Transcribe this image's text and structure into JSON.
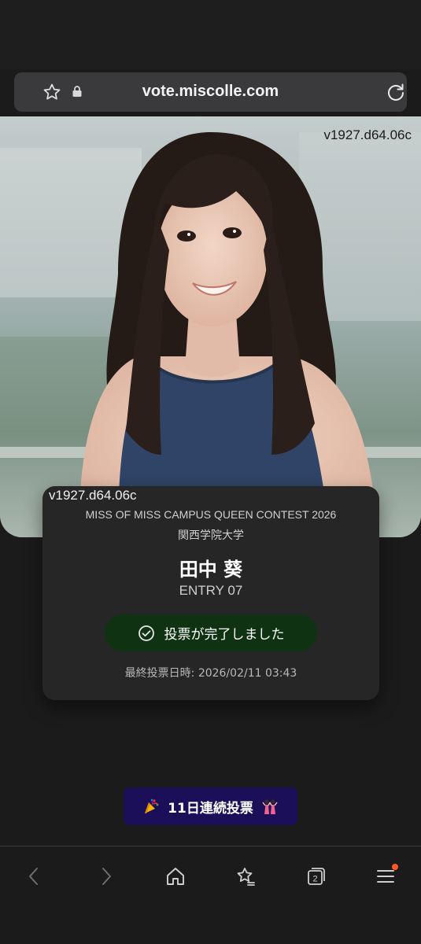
{
  "browser": {
    "url": "vote.miscolle.com"
  },
  "hero": {
    "version_label": "v1927.d64.06c"
  },
  "card": {
    "version_label": "v1927.d64.06c",
    "contest": "MISS OF MISS CAMPUS QUEEN CONTEST 2026",
    "university": "関西学院大学",
    "name": "田中 葵",
    "entry": "ENTRY 07",
    "vote_status": "投票が完了しました",
    "last_vote": "最終投票日時: 2026/02/11 03:43",
    "status_color": "#0f3213"
  },
  "streak": {
    "label": "11日連続投票",
    "color": "#1c0f5a"
  },
  "bottom_nav": {
    "tab_count": "2",
    "icons": [
      "back-icon",
      "forward-icon",
      "home-icon",
      "bookmark-star-icon",
      "tabs-icon",
      "menu-icon"
    ]
  }
}
